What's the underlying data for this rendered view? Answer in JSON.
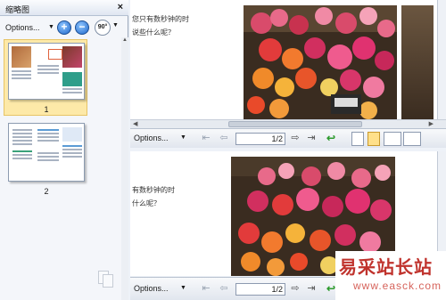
{
  "thumbnail_pane": {
    "title": "缩略图",
    "close": "×",
    "options_label": "Options...",
    "zoom_in": "+",
    "zoom_out": "−",
    "rotate_label": "90°",
    "thumbnails": [
      {
        "page": "1",
        "selected": true
      },
      {
        "page": "2",
        "selected": false
      }
    ]
  },
  "top_view": {
    "text_lines": [
      "您只有数秒钟的时",
      "说些什么呢？"
    ],
    "page_number": "1",
    "page_total": "/2",
    "options_label": "Options..."
  },
  "bottom_view": {
    "text_lines": [
      "有数秒钟的时",
      "什么呢？"
    ],
    "page_number": "1",
    "page_total": "/2",
    "options_label": "Options..."
  },
  "watermark": {
    "chinese": "易采站长站",
    "url": "www.easck.com"
  },
  "colors": {
    "selection": "#fde9a8",
    "accent_blue": "#1e66c9",
    "watermark_red": "#c0332d"
  }
}
